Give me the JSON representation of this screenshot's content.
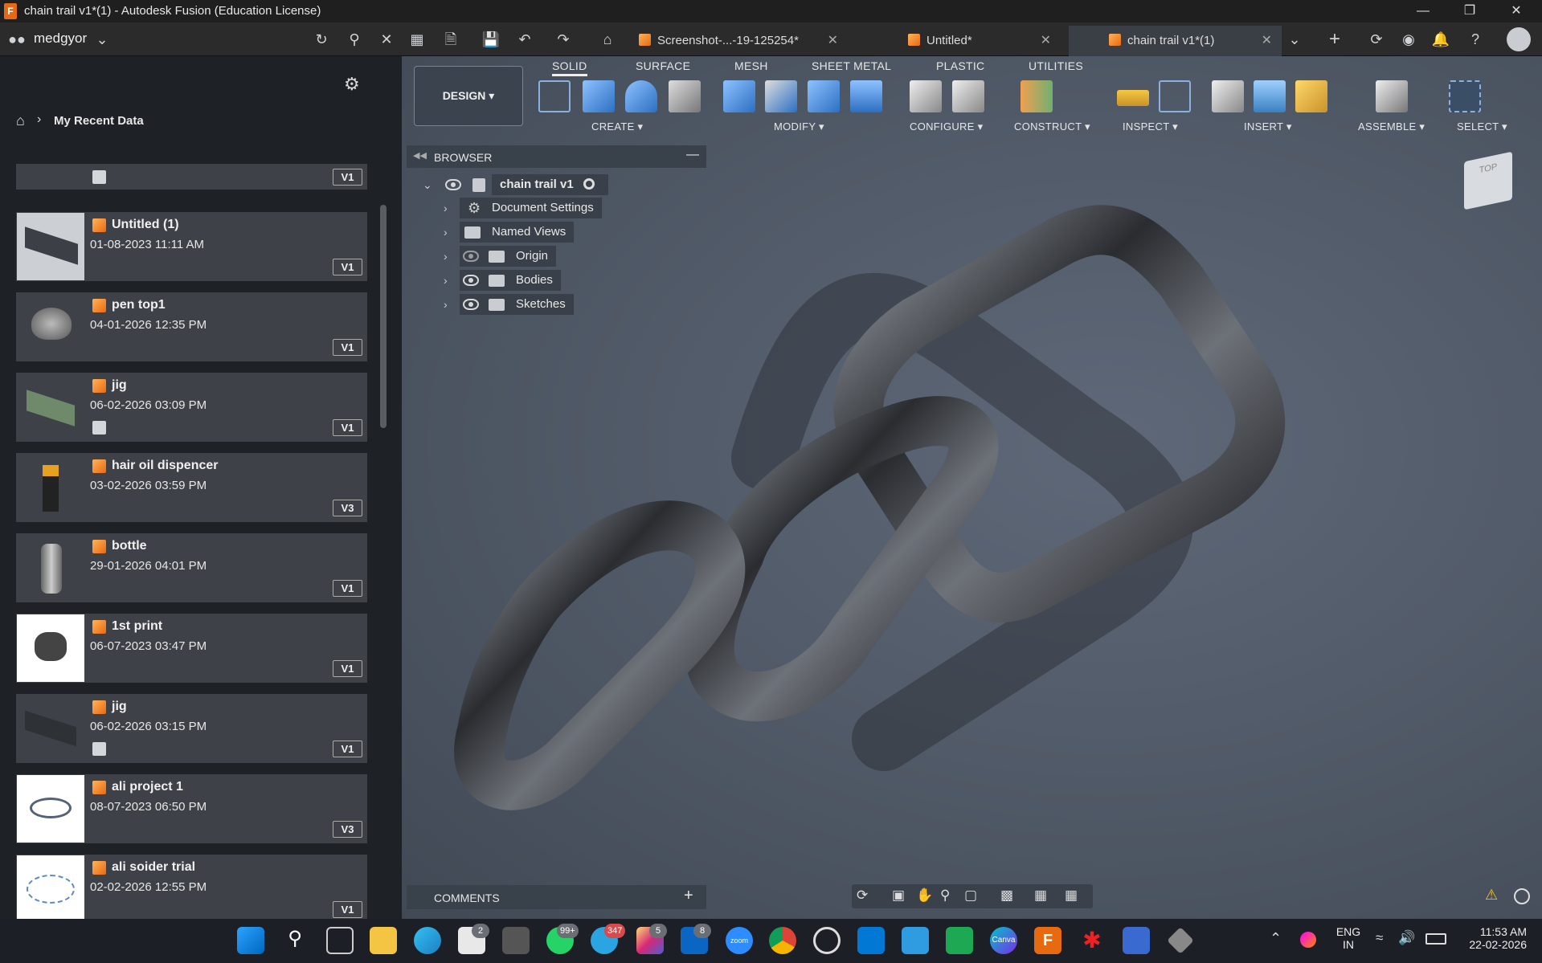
{
  "window": {
    "title": "chain trail v1*(1) - Autodesk Fusion (Education License)",
    "app_letter": "F"
  },
  "appbar": {
    "user": "medgyor",
    "tabs": [
      {
        "label": "Screenshot-...-19-125254*"
      },
      {
        "label": "Untitled*"
      },
      {
        "label": "chain trail v1*(1)"
      }
    ]
  },
  "data_panel": {
    "breadcrumb": "My Recent Data",
    "items": [
      {
        "name": "",
        "date": "",
        "version": "V1"
      },
      {
        "name": "Untitled (1)",
        "date": "01-08-2023 11:11 AM",
        "version": "V1"
      },
      {
        "name": "pen top1",
        "date": "04-01-2026 12:35 PM",
        "version": "V1"
      },
      {
        "name": "jig",
        "date": "06-02-2026 03:09 PM",
        "version": "V1"
      },
      {
        "name": "hair oil dispencer",
        "date": "03-02-2026 03:59 PM",
        "version": "V3"
      },
      {
        "name": "bottle",
        "date": "29-01-2026 04:01 PM",
        "version": "V1"
      },
      {
        "name": "1st print",
        "date": "06-07-2023 03:47 PM",
        "version": "V1"
      },
      {
        "name": "jig",
        "date": "06-02-2026 03:15 PM",
        "version": "V1"
      },
      {
        "name": "ali project 1",
        "date": "08-07-2023 06:50 PM",
        "version": "V3"
      },
      {
        "name": "ali soider trial",
        "date": "02-02-2026 12:55 PM",
        "version": "V1"
      }
    ]
  },
  "toolbar": {
    "workspace": "DESIGN",
    "tabs": [
      "SOLID",
      "SURFACE",
      "MESH",
      "SHEET METAL",
      "PLASTIC",
      "UTILITIES"
    ],
    "groups": [
      "CREATE",
      "MODIFY",
      "CONFIGURE",
      "CONSTRUCT",
      "INSPECT",
      "INSERT",
      "ASSEMBLE",
      "SELECT"
    ]
  },
  "browser": {
    "title": "BROWSER",
    "root": "chain trail v1",
    "nodes": [
      "Document Settings",
      "Named Views",
      "Origin",
      "Bodies",
      "Sketches"
    ]
  },
  "comments": {
    "title": "COMMENTS"
  },
  "viewcube": {
    "face": "TOP"
  },
  "taskbar": {
    "badges": {
      "gallery": "2",
      "whatsapp": "99+",
      "telegram": "347",
      "instagram": "5",
      "linkedin": "8"
    },
    "zoom_label": "zoom",
    "canva_label": "Canva",
    "fusion_label": "F",
    "language": "ENG",
    "region": "IN",
    "time": "11:53 AM",
    "date": "22-02-2026"
  },
  "colors": {
    "accent": "#e86a10",
    "panel": "#3e4248",
    "viewport": "#525b69"
  }
}
